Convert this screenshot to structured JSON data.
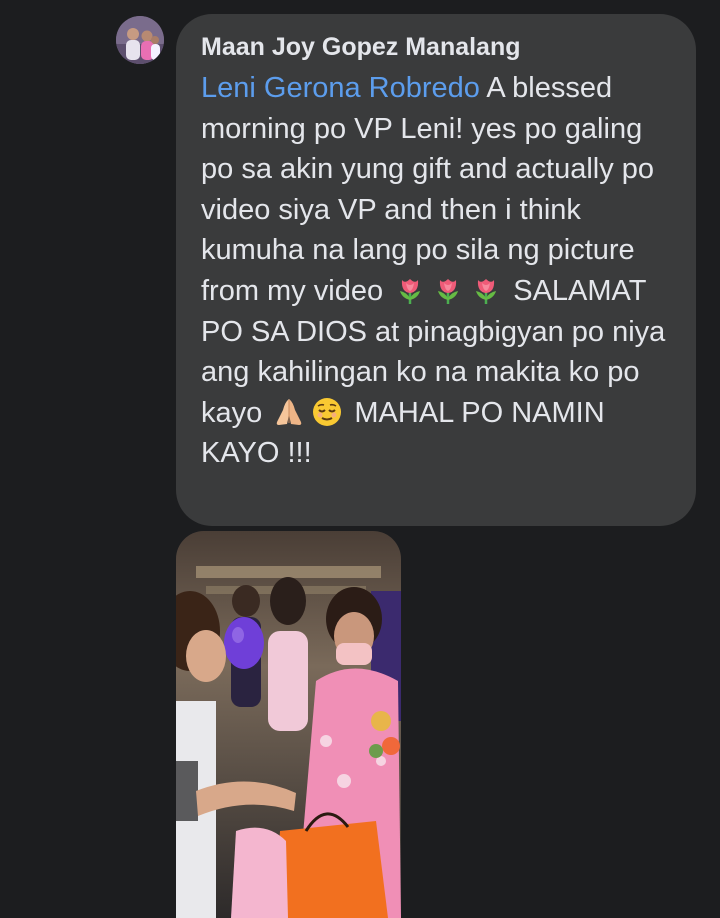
{
  "comment": {
    "author": "Maan Joy Gopez Manalang",
    "mention": "Leni Gerona Robredo",
    "segments": [
      " A blessed morning po VP Leni! yes po galing po sa akin yung gift and actually po video siya VP and then i think kumuha na lang po sila ng picture from my video ",
      " SALAMAT PO SA DIOS at pinagbigyan po niya ang kahilingan ko na makita ko po kayo ",
      " MAHAL PO NAMIN KAYO !!!"
    ],
    "emojis": [
      "tulip-icon",
      "tulip-icon",
      "tulip-icon",
      "folded-hands-icon",
      "relieved-face-icon"
    ]
  },
  "attachment": {
    "type": "photo"
  },
  "colors": {
    "background": "#1c1d1f",
    "bubble": "#3a3b3c",
    "text": "#e4e6eb",
    "mention": "#5c9ded"
  }
}
